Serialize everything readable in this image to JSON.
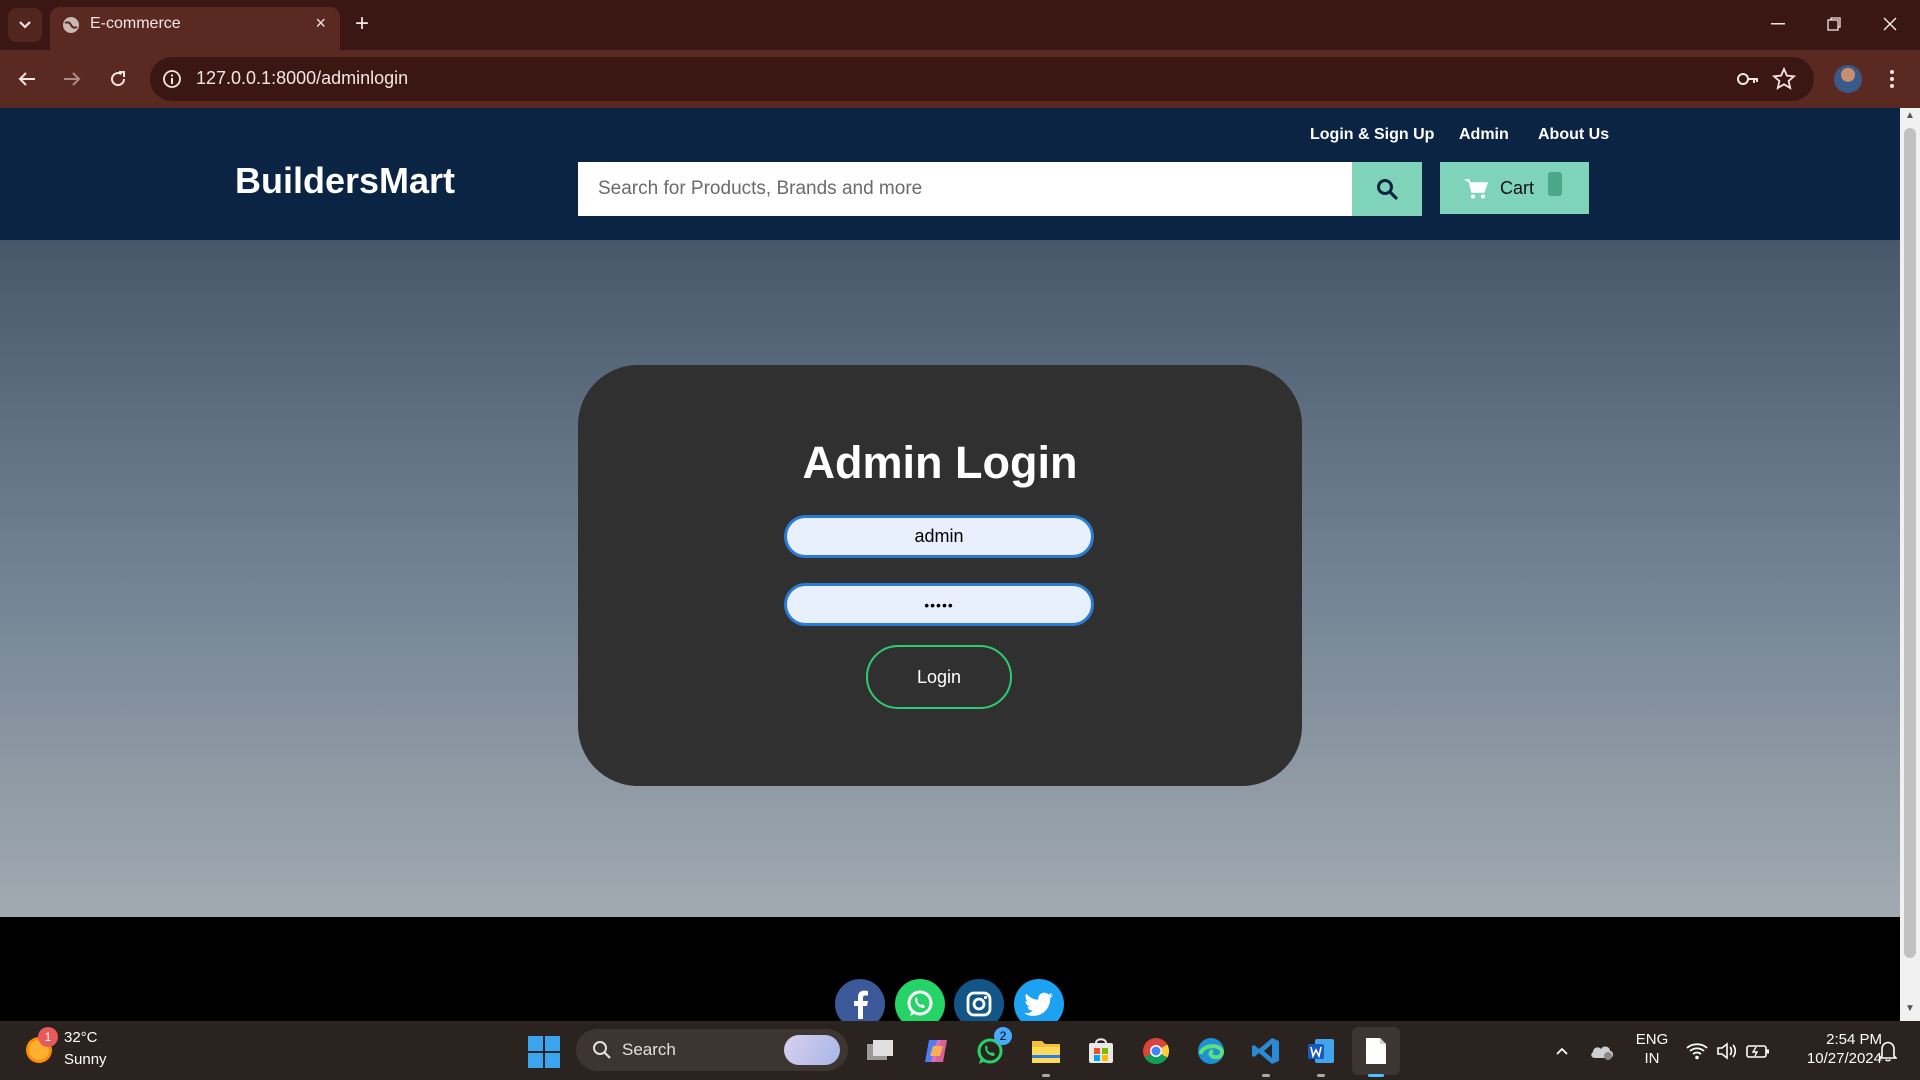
{
  "browser": {
    "tab_title": "E-commerce",
    "tab_close": "×",
    "new_tab": "+",
    "url": "127.0.0.1:8000/adminlogin"
  },
  "site": {
    "brand": "BuildersMart",
    "nav_links": [
      "Login & Sign Up",
      "Admin",
      "About Us"
    ],
    "search_placeholder": "Search for Products, Brands and more",
    "cart_label": "Cart",
    "accent_color": "#7fd3b8",
    "header_color": "#0b2444"
  },
  "login": {
    "title": "Admin Login",
    "username_value": "admin",
    "password_value": "•••••",
    "button_label": "Login"
  },
  "footer": {
    "social_icons": [
      "facebook-icon",
      "whatsapp-icon",
      "instagram-icon",
      "twitter-icon"
    ]
  },
  "taskbar": {
    "weather_temp": "32°C",
    "weather_condition": "Sunny",
    "weather_badge": "1",
    "search_label": "Search",
    "whatsapp_badge": "2",
    "lang_line1": "ENG",
    "lang_line2": "IN",
    "time": "2:54 PM",
    "date": "10/27/2024"
  }
}
